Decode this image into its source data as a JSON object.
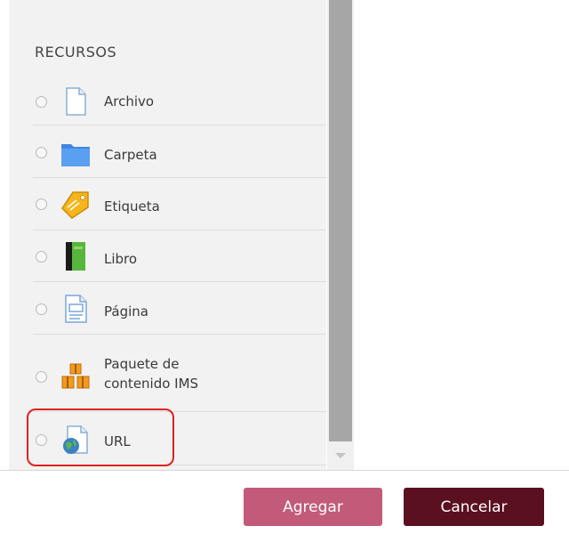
{
  "section": {
    "title": "RECURSOS"
  },
  "items": [
    {
      "label": "Archivo",
      "icon": "file-icon"
    },
    {
      "label": "Carpeta",
      "icon": "folder-icon"
    },
    {
      "label": "Etiqueta",
      "icon": "tag-icon"
    },
    {
      "label": "Libro",
      "icon": "book-icon"
    },
    {
      "label": "Página",
      "icon": "page-icon"
    },
    {
      "label": "Paquete de contenido IMS",
      "icon": "package-icon"
    },
    {
      "label": "URL",
      "icon": "url-globe-icon"
    }
  ],
  "footer": {
    "add_label": "Agregar",
    "cancel_label": "Cancelar"
  },
  "colors": {
    "add_button": "#c25b79",
    "cancel_button": "#5b1020",
    "highlight": "#e02020",
    "panel_background": "#f2f2f2"
  }
}
